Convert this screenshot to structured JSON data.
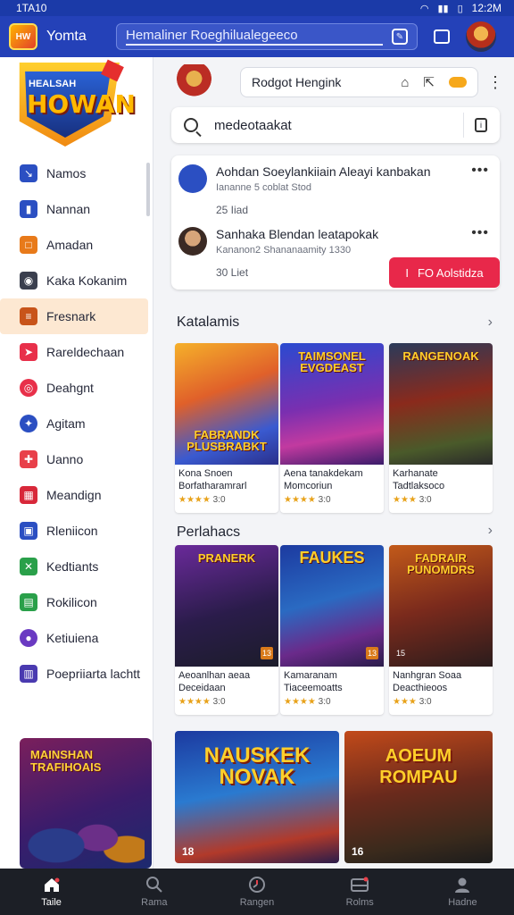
{
  "status_bar": {
    "left": "1TA10",
    "right": "12:2M"
  },
  "app_bar": {
    "logo_text": "HW",
    "app_name": "Yomta",
    "search_query": "Hemaliner Roeghilualegeeco"
  },
  "sidebar": {
    "brand_small": "HEALSAH",
    "brand_big": "HOWAN",
    "items": [
      {
        "label": "Namos",
        "icon": "wand-icon",
        "color": "#2b4fc2"
      },
      {
        "label": "Nannan",
        "icon": "bookmark-icon",
        "color": "#2b4fc2"
      },
      {
        "label": "Amadan",
        "icon": "square-icon",
        "color": "#e87a1a"
      },
      {
        "label": "Kaka Kokanim",
        "icon": "camera-icon",
        "color": "#3a3f4e"
      },
      {
        "label": "Fresnark",
        "icon": "list-icon",
        "color": "#c8541a"
      },
      {
        "label": "Rareldechaan",
        "icon": "arrow-icon",
        "color": "#e8304a"
      },
      {
        "label": "Deahgnt",
        "icon": "target-icon",
        "color": "#e8304a"
      },
      {
        "label": "Agitam",
        "icon": "compass-icon",
        "color": "#2b4fc2"
      },
      {
        "label": "Uanno",
        "icon": "puzzle-icon",
        "color": "#e8404a"
      },
      {
        "label": "Meandign",
        "icon": "grid-icon",
        "color": "#d8283a"
      },
      {
        "label": "Rleniicon",
        "icon": "image-icon",
        "color": "#2b4fc2"
      },
      {
        "label": "Kedtiants",
        "icon": "x-icon",
        "color": "#2aa04a"
      },
      {
        "label": "Rokilicon",
        "icon": "calendar-icon",
        "color": "#2aa04a"
      },
      {
        "label": "Ketiuiena",
        "icon": "user-icon",
        "color": "#6a3ac2"
      },
      {
        "label": "Poepriiarta lachtt",
        "icon": "chart-icon",
        "color": "#4a3ab0"
      }
    ],
    "promo_title": "MAINSHAN TRAFIHOAIS"
  },
  "address_bar": {
    "url": "Rodgot Hengink"
  },
  "search": {
    "value": "medeotaakat"
  },
  "notifications": [
    {
      "title": "Aohdan Soeylankiiain Aleayi kanbakan",
      "subtitle": "Iananne 5 coblat Stod",
      "time": "25 Iiad"
    },
    {
      "title": "Sanhaka Blendan leatapokak",
      "subtitle": "Kananon2 Shananaamity 1330",
      "time": "30 Liet"
    }
  ],
  "notification_cta": {
    "icon": "I",
    "label": "FO Aolstidza"
  },
  "section1": {
    "title": "Katalamis",
    "cards": [
      {
        "art_title": "FABRANDK PLUSBRABKT",
        "line1": "Kona Snoen",
        "line2": "Borfatharamrarl",
        "stars": "★★★★",
        "rating": "3:0"
      },
      {
        "art_title": "TAIMSONEL EVGDEAST",
        "line1": "Aena tanakdekam",
        "line2": "Momcoriun",
        "stars": "★★★★",
        "rating": "3:0"
      },
      {
        "art_title": "RANGENOAK",
        "line1": "Karhanate",
        "line2": "Tadtlaksoco",
        "stars": "★★★",
        "rating": "3:0"
      }
    ]
  },
  "section2": {
    "title": "Perlahacs",
    "cards": [
      {
        "art_title": "PRANERK",
        "line1": "Aeoanlhan aeaa",
        "line2": "Deceidaan",
        "stars": "★★★★",
        "rating": "3:0",
        "badge": "13"
      },
      {
        "art_title": "FAUKES",
        "line1": "Kamaranam",
        "line2": "Tiaceemoatts",
        "stars": "★★★★",
        "rating": "3:0",
        "badge": "13"
      },
      {
        "art_title": "FADRAIR PUNOMDRS",
        "line1": "Nanhgran Soaa",
        "line2": "Deacthieoos",
        "stars": "★★★",
        "rating": "3:0",
        "badge": "15"
      }
    ]
  },
  "section3": {
    "cards": [
      {
        "art_title": "NAUSKEK NOVAK",
        "number": "18"
      },
      {
        "art_title": "AOEUM ROMPAU",
        "number": "16"
      }
    ]
  },
  "bottom_nav": [
    {
      "label": "Taile",
      "icon": "home-icon"
    },
    {
      "label": "Rama",
      "icon": "search-icon"
    },
    {
      "label": "Rangen",
      "icon": "clock-icon"
    },
    {
      "label": "Rolms",
      "icon": "inbox-icon"
    },
    {
      "label": "Hadne",
      "icon": "profile-icon"
    }
  ]
}
